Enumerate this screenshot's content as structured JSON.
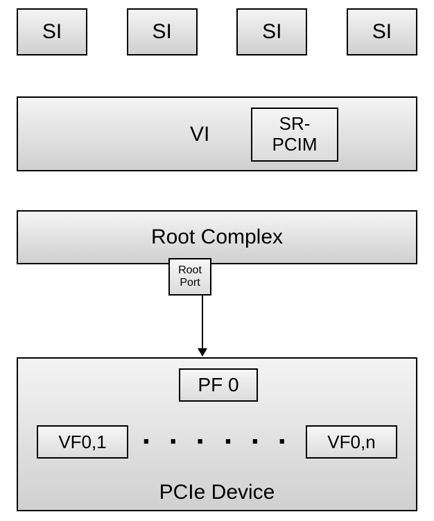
{
  "si": [
    "SI",
    "SI",
    "SI",
    "SI"
  ],
  "vi": {
    "label": "VI",
    "sr_pcim": "SR-\nPCIM"
  },
  "root_complex": {
    "label": "Root Complex",
    "root_port": "Root\nPort"
  },
  "pcie_device": {
    "pf": "PF 0",
    "vf_first": "VF0,1",
    "vf_last": "VF0,n",
    "dots1": "· · ·",
    "dots2": "· · ·",
    "label": "PCIe Device"
  }
}
